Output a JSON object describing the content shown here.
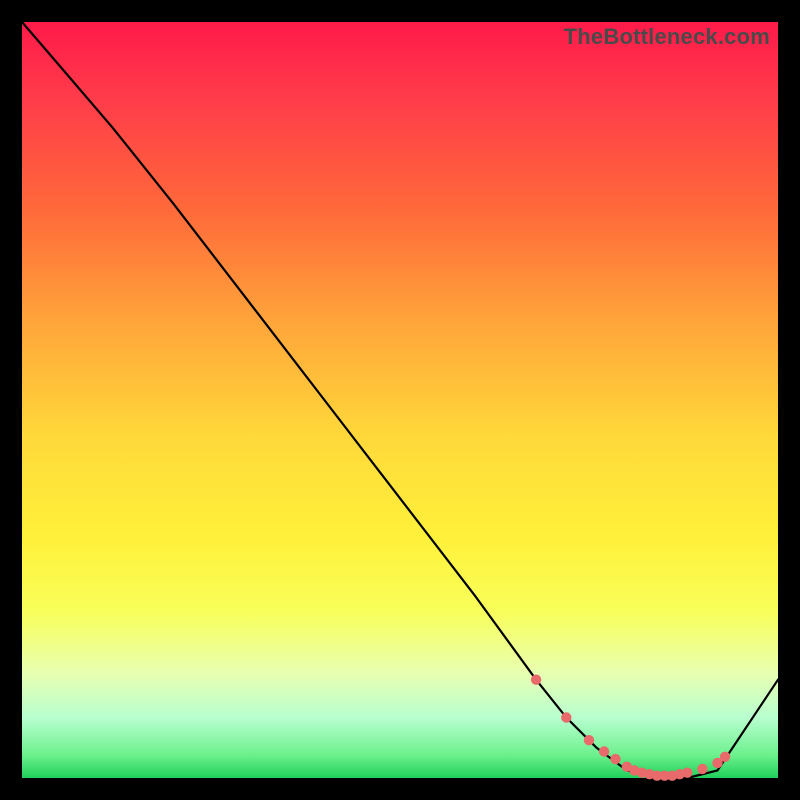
{
  "watermark": "TheBottleneck.com",
  "chart_data": {
    "type": "line",
    "title": "",
    "xlabel": "",
    "ylabel": "",
    "xlim": [
      0,
      100
    ],
    "ylim": [
      0,
      100
    ],
    "grid": false,
    "legend": false,
    "series": [
      {
        "name": "bottleneck-curve",
        "x": [
          0,
          6,
          12,
          20,
          30,
          40,
          50,
          60,
          68,
          72,
          76,
          80,
          84,
          88,
          92,
          100
        ],
        "y": [
          100,
          93,
          86,
          76,
          63,
          50,
          37,
          24,
          13,
          8,
          4,
          1,
          0,
          0,
          1,
          13
        ]
      }
    ],
    "markers": {
      "name": "emphasis-dots",
      "x": [
        68,
        72,
        75,
        77,
        78.5,
        80,
        81,
        82,
        83,
        84,
        85,
        86,
        87,
        88,
        90,
        92,
        93
      ],
      "y": [
        13,
        8,
        5,
        3.5,
        2.5,
        1.5,
        1.0,
        0.7,
        0.5,
        0.3,
        0.3,
        0.3,
        0.5,
        0.7,
        1.2,
        2.0,
        2.8
      ]
    },
    "colors": {
      "line": "#000000",
      "marker": "#e86a6a"
    }
  }
}
